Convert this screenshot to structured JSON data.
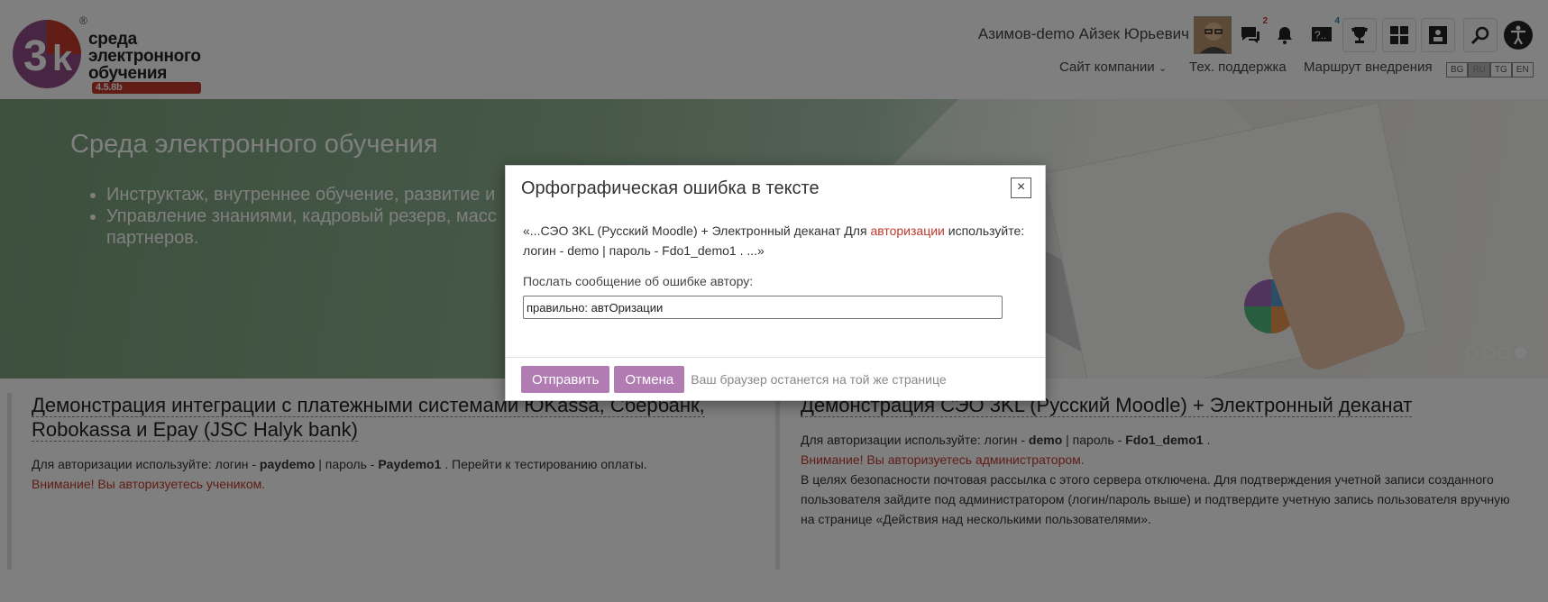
{
  "header": {
    "logo": {
      "line1": "среда",
      "line2": "электронного",
      "line3": "обучения",
      "version": "4.5.8b",
      "registered": "®"
    },
    "user_name": "Азимов-demo Айзек Юрьевич",
    "badges": {
      "messages": "2",
      "questions": "4"
    },
    "nav": {
      "company": "Сайт компании",
      "support": "Тех. поддержка",
      "route": "Маршрут внедрения"
    },
    "languages": [
      "BG",
      "RU",
      "TG",
      "EN"
    ],
    "active_language": "RU"
  },
  "banner": {
    "title": "Среда электронного обучения",
    "items": [
      "Инструктаж, внутреннее обучение, развитие и",
      "Управление знаниями, кадровый резерв, масс",
      "партнеров."
    ]
  },
  "cards": [
    {
      "title": "Демонстрация интеграции с платежными системами ЮKassa, Сбербанк, Robokassa и Epay (JSC Halyk bank)",
      "login_prefix": "Для авторизации используйте: логин - ",
      "login": "paydemo",
      "pass_prefix": " | пароль - ",
      "password": "Paydemo1",
      "suffix": " . Перейти к тестированию оплаты.",
      "warning": "Внимание! Вы авторизуетесь учеником."
    },
    {
      "title": "Демонстрация СЭО 3KL (Русский Moodle) + Электронный деканат",
      "login_prefix": "Для авторизации используйте: логин - ",
      "login": "demo",
      "pass_prefix": " | пароль - ",
      "password": "Fdo1_demo1",
      "suffix": " .",
      "warning": "Внимание! Вы авторизуетесь администратором.",
      "note": "В целях безопасности почтовая рассылка с этого сервера отключена. Для подтверждения учетной записи созданного пользователя зайдите под администратором (логин/пароль выше) и подтвердите учетную запись пользователя вручную на странице «Действия над несколькими пользователями»."
    }
  ],
  "modal": {
    "title": "Орфографическая ошибка в тексте",
    "close": "×",
    "quote_before": "«...СЭО 3KL (Русский Moodle) + Электронный деканат Для ",
    "quote_error": "авторизации",
    "quote_after": " используйте: логин - demo | пароль - Fdo1_demo1 . ...»",
    "send_label": "Послать сообщение об ошибке автору:",
    "input_value": "правильно: автОризации",
    "send_button": "Отправить",
    "cancel_button": "Отмена",
    "foot_note": "Ваш браузер останется на той же странице"
  },
  "colors": {
    "accent": "#b07cb2",
    "error": "#c0392b",
    "banner_green": "#7aa07c"
  }
}
